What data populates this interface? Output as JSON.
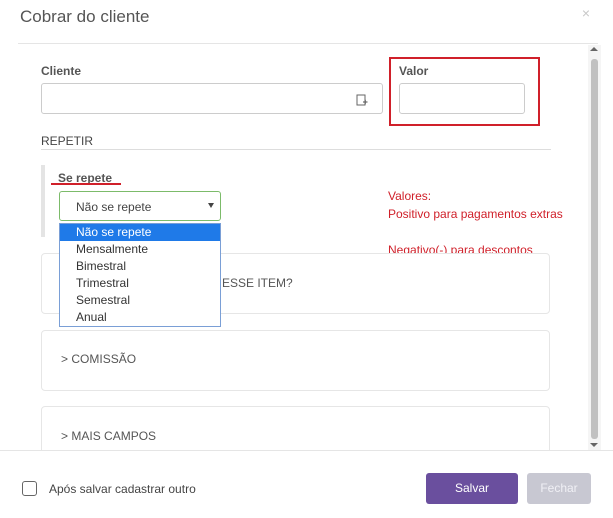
{
  "modal": {
    "title": "Cobrar do cliente",
    "close_icon": "×"
  },
  "fields": {
    "cliente_label": "Cliente",
    "cliente_value": "",
    "valor_label": "Valor",
    "valor_value": ""
  },
  "repeat": {
    "section_title": "REPETIR",
    "label": "Se repete",
    "selected": "Não se repete",
    "options": [
      "Não se repete",
      "Mensalmente",
      "Bimestral",
      "Trimestral",
      "Semestral",
      "Anual"
    ]
  },
  "notes": {
    "line1": "Valores:",
    "line2": "Positivo para pagamentos extras",
    "line3": "Negativo(-) para descontos"
  },
  "cards": {
    "hidden_card_tail": "ESSE ITEM?",
    "comissao": "COMISSÃO",
    "mais_campos": "MAIS CAMPOS",
    "chevron": ">"
  },
  "footer": {
    "checkbox_label": "Após salvar cadastrar outro",
    "save_label": "Salvar",
    "close_label": "Fechar"
  },
  "colors": {
    "primary": "#6a4f9e",
    "annotation": "#d0202a",
    "selected_option": "#1f7ae8",
    "valid_border": "#7cbb6a"
  }
}
